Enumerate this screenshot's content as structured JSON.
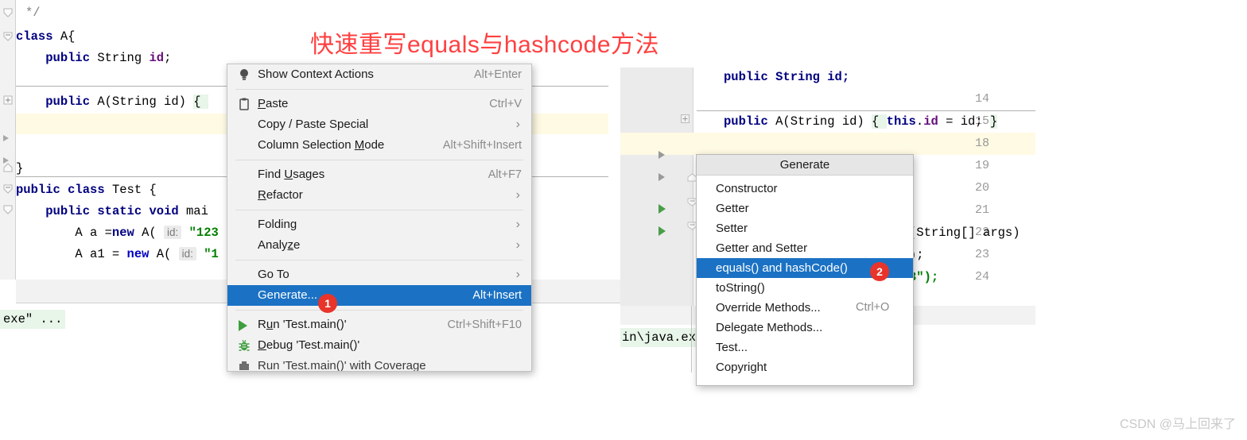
{
  "title_annotation": "快速重写equals与hashcode方法",
  "watermark": "CSDN @马上回来了",
  "left_editor": {
    "lines": [
      {
        "text": "*/",
        "kind": "comment"
      },
      {
        "text": "class A{",
        "kind": "code"
      },
      {
        "text": "public String id;",
        "kind": "code"
      },
      {
        "text": "public A(String id) {",
        "kind": "code"
      },
      {
        "text": "}",
        "kind": "code"
      },
      {
        "text": "public class Test {",
        "kind": "code"
      },
      {
        "text": "public static void mai",
        "kind": "code"
      },
      {
        "text": "A a =new A( id: \"123",
        "kind": "code"
      },
      {
        "text": "A a1 = new A( id: \"1",
        "kind": "code"
      }
    ],
    "console_text": "exe\" ..."
  },
  "right_editor": {
    "line_numbers": [
      "14",
      "15",
      "18",
      "19",
      "20",
      "21",
      "22",
      "23",
      "24"
    ],
    "code_line_15": "public A(String id) { this.id = id; }",
    "code_args": "(String[] args)",
    "code_semi": ");",
    "code_str_tail": "3\");",
    "console_text": "in\\java.ex"
  },
  "context_menu": {
    "items": [
      {
        "label": "Show Context Actions",
        "shortcut": "Alt+Enter",
        "icon": "lightbulb-icon",
        "submenu": false,
        "selected": false,
        "mnemonic": -1
      },
      {
        "separator": true
      },
      {
        "label": "Paste",
        "shortcut": "Ctrl+V",
        "icon": "clipboard-icon",
        "submenu": false,
        "selected": false,
        "mnemonic": 0
      },
      {
        "label": "Copy / Paste Special",
        "shortcut": "",
        "icon": "",
        "submenu": true,
        "selected": false,
        "mnemonic": -1
      },
      {
        "label": "Column Selection Mode",
        "shortcut": "Alt+Shift+Insert",
        "icon": "",
        "submenu": false,
        "selected": false,
        "mnemonic": 17
      },
      {
        "separator": true
      },
      {
        "label": "Find Usages",
        "shortcut": "Alt+F7",
        "icon": "",
        "submenu": false,
        "selected": false,
        "mnemonic": 5
      },
      {
        "label": "Refactor",
        "shortcut": "",
        "icon": "",
        "submenu": true,
        "selected": false,
        "mnemonic": 0
      },
      {
        "separator": true
      },
      {
        "label": "Folding",
        "shortcut": "",
        "icon": "",
        "submenu": true,
        "selected": false,
        "mnemonic": -1
      },
      {
        "label": "Analyze",
        "shortcut": "",
        "icon": "",
        "submenu": true,
        "selected": false,
        "mnemonic": 5
      },
      {
        "separator": true
      },
      {
        "label": "Go To",
        "shortcut": "",
        "icon": "",
        "submenu": true,
        "selected": false,
        "mnemonic": -1
      },
      {
        "label": "Generate...",
        "shortcut": "Alt+Insert",
        "icon": "",
        "submenu": false,
        "selected": true,
        "mnemonic": -1
      },
      {
        "separator": true
      },
      {
        "label": "Run 'Test.main()'",
        "shortcut": "Ctrl+Shift+F10",
        "icon": "run-icon",
        "submenu": false,
        "selected": false,
        "mnemonic": 1
      },
      {
        "label": "Debug 'Test.main()'",
        "shortcut": "",
        "icon": "debug-icon",
        "submenu": false,
        "selected": false,
        "mnemonic": 0
      }
    ]
  },
  "generate_popup": {
    "header": "Generate",
    "items": [
      {
        "label": "Constructor",
        "shortcut": "",
        "selected": false
      },
      {
        "label": "Getter",
        "shortcut": "",
        "selected": false
      },
      {
        "label": "Setter",
        "shortcut": "",
        "selected": false
      },
      {
        "label": "Getter and Setter",
        "shortcut": "",
        "selected": false
      },
      {
        "label": "equals() and hashCode()",
        "shortcut": "",
        "selected": true
      },
      {
        "label": "toString()",
        "shortcut": "",
        "selected": false
      },
      {
        "label": "Override Methods...",
        "shortcut": "Ctrl+O",
        "selected": false
      },
      {
        "label": "Delegate Methods...",
        "shortcut": "",
        "selected": false
      },
      {
        "label": "Test...",
        "shortcut": "",
        "selected": false
      },
      {
        "label": "Copyright",
        "shortcut": "",
        "selected": false
      }
    ]
  },
  "badges": [
    {
      "number": "1",
      "target": "generate-menu-item"
    },
    {
      "number": "2",
      "target": "equals-and-hashcode-item"
    }
  ],
  "colors": {
    "accent_selection": "#1b72c4",
    "badge_red": "#e8342a",
    "title_red": "#ff4040",
    "highlight_yellow": "#fffae3",
    "highlight_green": "#e8f5e9"
  }
}
